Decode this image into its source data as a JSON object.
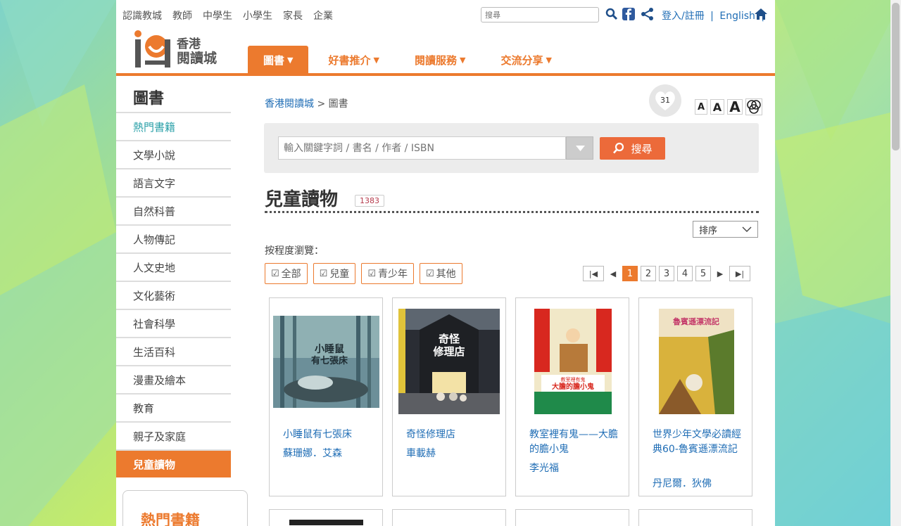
{
  "top_links": [
    "認識教城",
    "教師",
    "中學生",
    "小學生",
    "家長",
    "企業"
  ],
  "search_small_placeholder": "搜尋",
  "login": {
    "label": "登入/註冊",
    "sep1": "|",
    "english": "English",
    "sep2": "|"
  },
  "logo": {
    "line1": "香港",
    "line2": "閱讀城"
  },
  "nav": [
    {
      "label": "圖書"
    },
    {
      "label": "好書推介"
    },
    {
      "label": "閱讀服務"
    },
    {
      "label": "交流分享"
    }
  ],
  "sidebar": {
    "title": "圖書",
    "items": [
      "熱門書籍",
      "文學小說",
      "語言文字",
      "自然科普",
      "人物傳記",
      "人文史地",
      "文化藝術",
      "社會科學",
      "生活百科",
      "漫畫及繪本",
      "教育",
      "親子及家庭",
      "兒童讀物"
    ],
    "box_title": "熱門書籍"
  },
  "breadcrumb": {
    "home": "香港閱讀城",
    "sep": ">",
    "current": "圖書"
  },
  "like_count": "31",
  "font_sizes": [
    "A",
    "A",
    "A"
  ],
  "search": {
    "placeholder": "輸入關鍵字詞 / 書名 / 作者 / ISBN",
    "button": "搜尋"
  },
  "category": {
    "title": "兒童讀物",
    "count": "1383"
  },
  "sort_label": "排序",
  "level_label": "按程度瀏覽：",
  "filters": [
    "全部",
    "兒童",
    "青少年",
    "其他"
  ],
  "pagination": {
    "pages": [
      "1",
      "2",
      "3",
      "4",
      "5"
    ],
    "current": "1"
  },
  "books": [
    {
      "title": "小睡鼠有七張床",
      "author": "蘇珊娜．艾森",
      "cover_text": [
        "小睡鼠",
        "有七張床"
      ]
    },
    {
      "title": "奇怪修理店",
      "author": "車載赫",
      "cover_text": [
        "奇怪",
        "修理店"
      ]
    },
    {
      "title": "教室裡有鬼——大膽的膽小鬼",
      "author": "李光福",
      "cover_text": [
        "教室裡有鬼",
        "大膽的膽小鬼"
      ]
    },
    {
      "title": "世界少年文學必讀經典60-魯賓遜漂流記",
      "author": "丹尼爾．狄佛",
      "cover_text": [
        "魯賓遜漂流記"
      ]
    }
  ],
  "colors": {
    "brand_orange": "#ec7a2e",
    "link_blue": "#1f6db5",
    "teal": "#2aa0a8"
  }
}
